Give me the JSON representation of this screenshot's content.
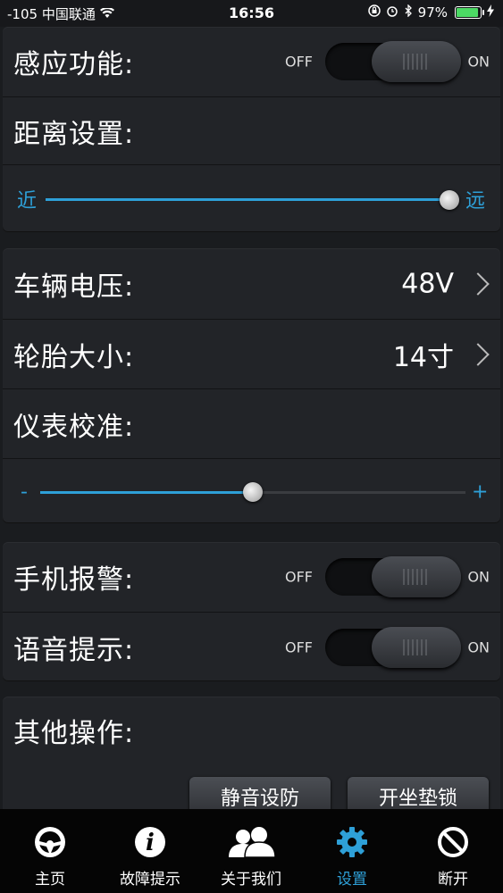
{
  "status": {
    "signal": "-105",
    "carrier": "中国联通",
    "time": "16:56",
    "battery": "97%"
  },
  "settings": {
    "induction": {
      "label": "感应功能:",
      "off": "OFF",
      "on": "ON",
      "state": "on"
    },
    "distance": {
      "label": "距离设置:",
      "min_label": "近",
      "max_label": "远",
      "value_pct": 100
    },
    "voltage": {
      "label": "车辆电压:",
      "value": "48V"
    },
    "tire": {
      "label": "轮胎大小:",
      "value": "14寸"
    },
    "calibration": {
      "label": "仪表校准:",
      "min_label": "-",
      "max_label": "+",
      "value_pct": 50
    },
    "phone_alarm": {
      "label": "手机报警:",
      "off": "OFF",
      "on": "ON",
      "state": "on"
    },
    "voice": {
      "label": "语音提示:",
      "off": "OFF",
      "on": "ON",
      "state": "on"
    },
    "other": {
      "label": "其他操作:",
      "mute_btn": "静音设防",
      "seat_btn": "开坐垫锁"
    }
  },
  "tabs": [
    {
      "label": "主页",
      "icon": "steering-wheel-icon"
    },
    {
      "label": "故障提示",
      "icon": "info-icon"
    },
    {
      "label": "关于我们",
      "icon": "users-icon"
    },
    {
      "label": "设置",
      "icon": "gear-icon"
    },
    {
      "label": "断开",
      "icon": "disconnect-icon"
    }
  ],
  "colors": {
    "accent": "#2ea0d8",
    "background": "#1a1c1f"
  }
}
